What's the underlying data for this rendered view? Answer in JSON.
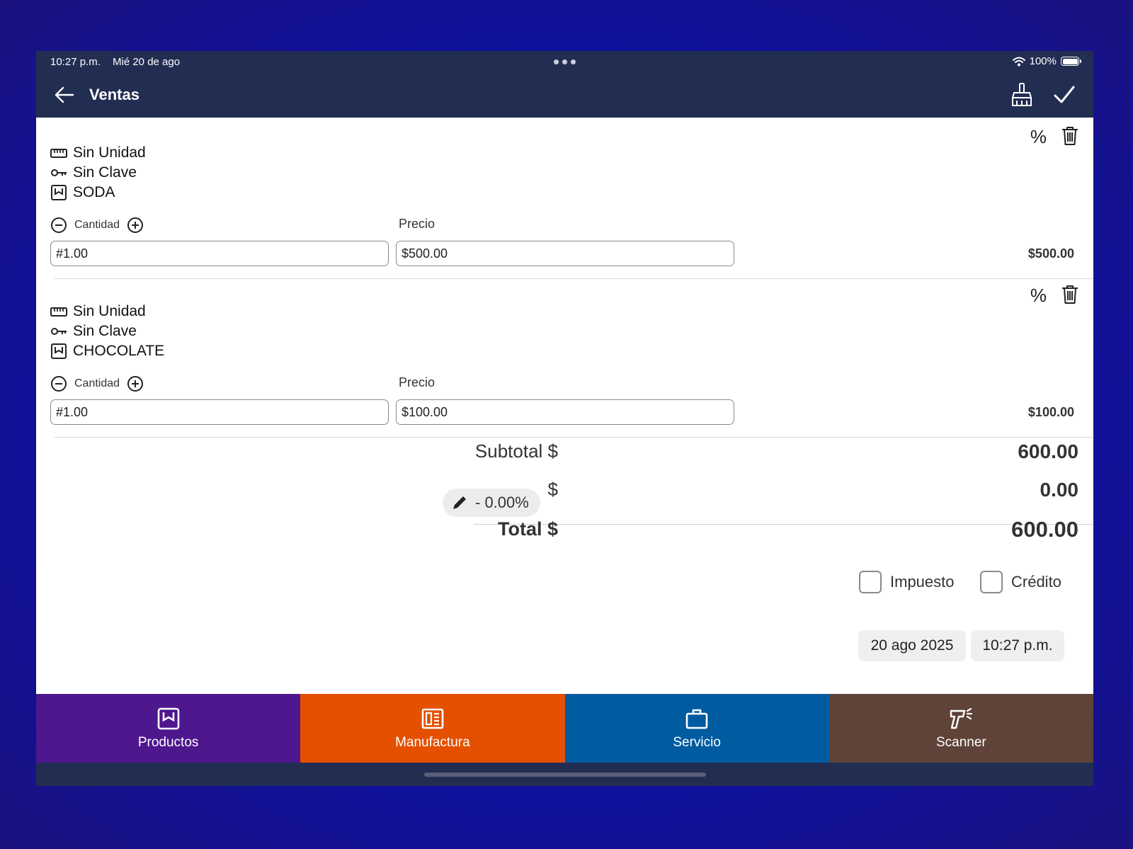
{
  "status_bar": {
    "time": "10:27 p.m.",
    "date": "Mié 20 de ago",
    "battery": "100%",
    "wifi_icon": "wifi-icon",
    "battery_icon": "battery-icon"
  },
  "nav": {
    "title": "Ventas",
    "back_icon": "arrow-left-icon",
    "clear_icon": "broom-icon",
    "confirm_icon": "checkmark-icon"
  },
  "items": [
    {
      "unit": "Sin Unidad",
      "key": "Sin Clave",
      "name": "SODA",
      "qty_label": "Cantidad",
      "price_label": "Precio",
      "qty_value": "#1.00",
      "price_value": "$500.00",
      "line_total": "$500.00",
      "discount_symbol": "%"
    },
    {
      "unit": "Sin Unidad",
      "key": "Sin Clave",
      "name": "CHOCOLATE",
      "qty_label": "Cantidad",
      "price_label": "Precio",
      "qty_value": "#1.00",
      "price_value": "$100.00",
      "line_total": "$100.00",
      "discount_symbol": "%"
    }
  ],
  "summary": {
    "subtotal_label": "Subtotal $",
    "subtotal_value": "600.00",
    "discount_pill": "- 0.00%",
    "discount_currency": "$",
    "discount_value": "0.00",
    "total_label": "Total $",
    "total_value": "600.00"
  },
  "options": {
    "tax_label": "Impuesto",
    "credit_label": "Crédito",
    "tax_checked": false,
    "credit_checked": false
  },
  "datetime": {
    "date": "20 ago 2025",
    "time": "10:27 p.m."
  },
  "tabs": [
    {
      "label": "Productos",
      "icon": "product-box-icon",
      "color": "#4e178e"
    },
    {
      "label": "Manufactura",
      "icon": "manufacturing-icon",
      "color": "#e55000"
    },
    {
      "label": "Servicio",
      "icon": "briefcase-icon",
      "color": "#005ba1"
    },
    {
      "label": "Scanner",
      "icon": "barcode-scanner-icon",
      "color": "#5f4338"
    }
  ],
  "colors": {
    "header_bg": "#222d52",
    "page_bg": "#0a10a8"
  }
}
